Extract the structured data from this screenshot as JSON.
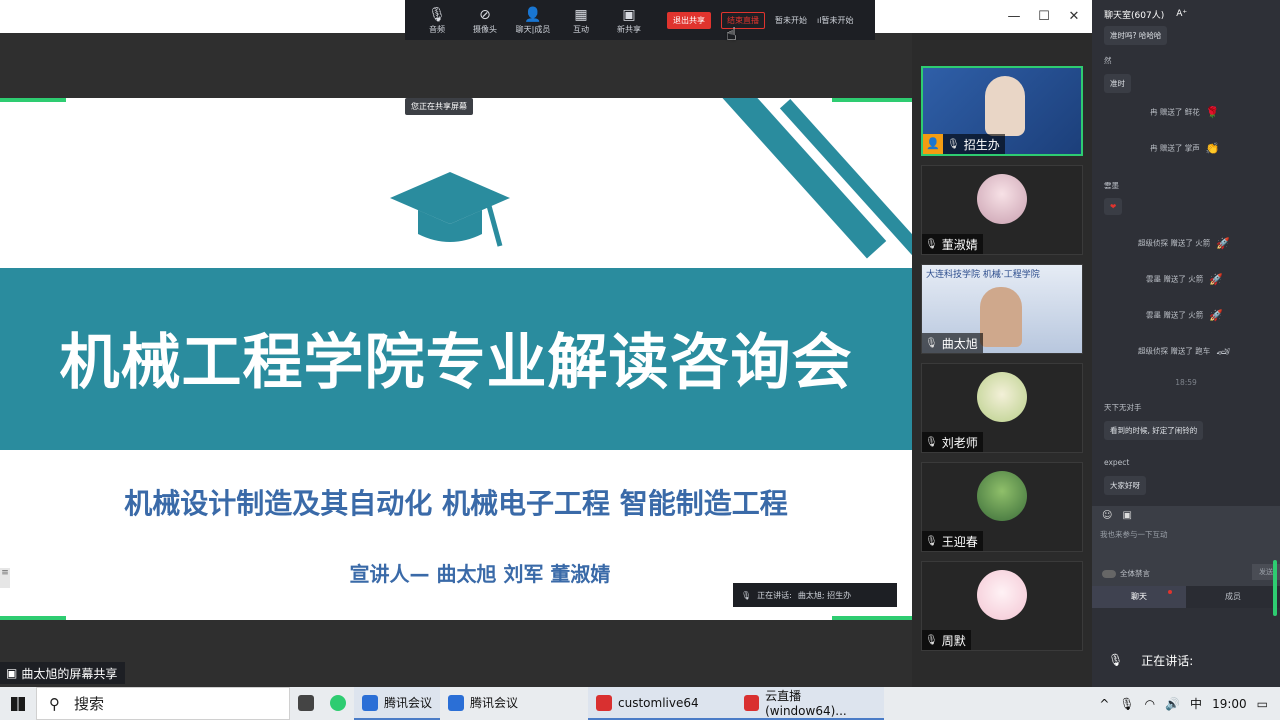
{
  "toolbar": {
    "items": [
      {
        "label": "音频",
        "icon": "microphone-icon"
      },
      {
        "label": "摄像头",
        "icon": "camera-off-icon"
      },
      {
        "label": "聊天|成员",
        "icon": "members-icon"
      },
      {
        "label": "互动",
        "icon": "apps-icon"
      },
      {
        "label": "新共享",
        "icon": "share-screen-icon"
      }
    ],
    "stop_share": "退出共享",
    "live": "结束直播",
    "pause_start": "暂未开始",
    "record": "暂未开始"
  },
  "slide": {
    "sharing_tag": "您正在共享屏幕",
    "title": "机械工程学院专业解读咨询会",
    "subjects": "机械设计制造及其自动化  机械电子工程  智能制造工程",
    "speakers": "宣讲人—  曲太旭  刘军  董淑婧",
    "speaking_bar_label": "正在讲话:",
    "speaking_bar_names": "曲太旭; 招生办"
  },
  "screenshare_label": "曲太旭的屏幕共享",
  "participants": [
    {
      "name": "招生办",
      "host": true
    },
    {
      "name": "董淑婧"
    },
    {
      "name": "曲太旭"
    },
    {
      "name": "刘老师"
    },
    {
      "name": "王迎春"
    },
    {
      "name": "周默"
    }
  ],
  "tile_school_banner": "大连科技学院    机械·工程学院",
  "chat": {
    "room": "聊天室(607人)",
    "font_btn": "A⁺",
    "messages": [
      {
        "text": "准时吗? 哈哈哈",
        "kind": "bubble"
      },
      {
        "text": "然",
        "kind": "plain"
      },
      {
        "text": "准时",
        "kind": "bubble"
      },
      {
        "text": "冉 赠送了 鲜花",
        "kind": "gift",
        "gift": "🌹"
      },
      {
        "text": "冉 赠送了 掌声",
        "kind": "gift",
        "gift": "👏"
      },
      {
        "text": "雲墨",
        "kind": "plain"
      },
      {
        "text": "❤",
        "kind": "bubble"
      },
      {
        "text": "超级侦探 赠送了 火箭",
        "kind": "gift",
        "gift": "🚀"
      },
      {
        "text": "雲墨 赠送了 火箭",
        "kind": "gift",
        "gift": "🚀"
      },
      {
        "text": "雲墨 赠送了 火箭",
        "kind": "gift",
        "gift": "🚀"
      },
      {
        "text": "超级侦探 赠送了 跑车",
        "kind": "gift",
        "gift": "🏎"
      },
      {
        "text": "18:59",
        "kind": "time"
      },
      {
        "text": "天下无对手",
        "kind": "plain"
      },
      {
        "text": "看到的时候, 好定了闹铃的",
        "kind": "bubble"
      },
      {
        "text": "expect",
        "kind": "plain"
      },
      {
        "text": "大家好呀",
        "kind": "bubble"
      }
    ],
    "input_placeholder": "我也来参与一下互动",
    "mute_all": "全体禁言",
    "send": "发送",
    "tab_chat": "聊天",
    "tab_members": "成员",
    "speaking_now": "正在讲话:"
  },
  "taskbar": {
    "search": "搜索",
    "apps": [
      "腾讯会议",
      "腾讯会议",
      "customlive64",
      "云直播(window64)..."
    ],
    "tray_lang": "中",
    "time": "19:00"
  }
}
